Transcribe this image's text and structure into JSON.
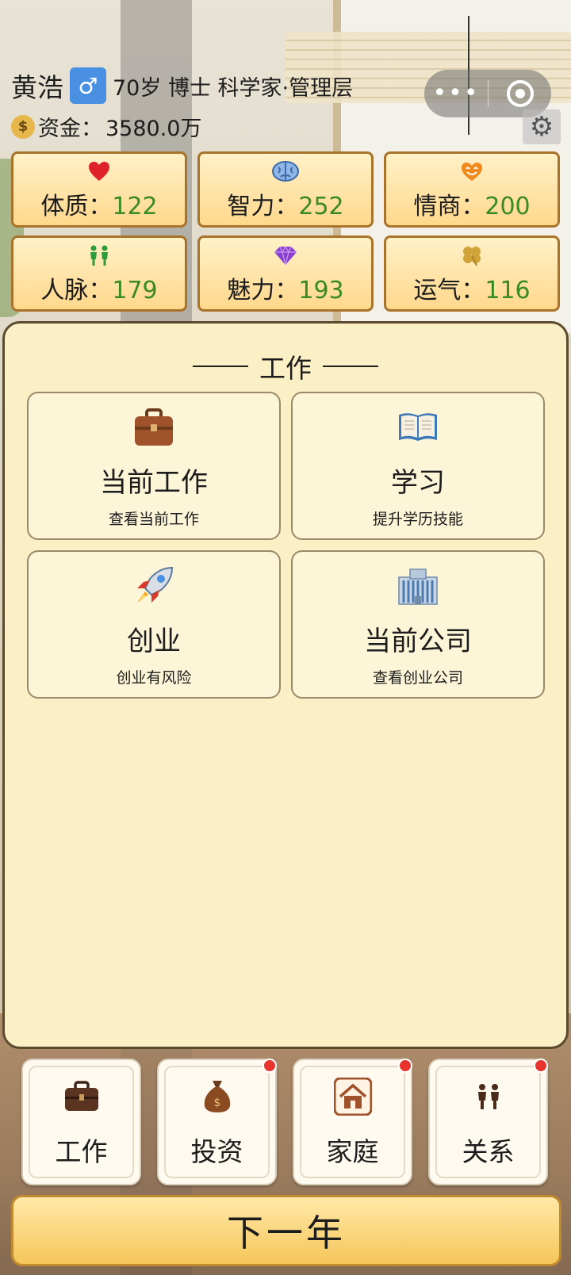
{
  "player": {
    "name": "黄浩",
    "gender_symbol": "♂",
    "info": "70岁 博士 科学家·管理层",
    "funds_label": "资金：",
    "funds_value": "3580.0万"
  },
  "capsule": {
    "more": "•••"
  },
  "stats": [
    {
      "label": "体质：",
      "value": "122",
      "icon": "heart-icon",
      "color": "#e0232a"
    },
    {
      "label": "智力：",
      "value": "252",
      "icon": "brain-icon",
      "color": "#4a7fc1"
    },
    {
      "label": "情商：",
      "value": "200",
      "icon": "smile-icon",
      "color": "#f08a1c"
    },
    {
      "label": "人脉：",
      "value": "179",
      "icon": "people-icon",
      "color": "#2e9c3a"
    },
    {
      "label": "魅力：",
      "value": "193",
      "icon": "gem-icon",
      "color": "#7a35c0"
    },
    {
      "label": "运气：",
      "value": "116",
      "icon": "clover-icon",
      "color": "#d1a43a"
    }
  ],
  "work_panel": {
    "title": "工作",
    "cards": [
      {
        "title": "当前工作",
        "subtitle": "查看当前工作",
        "icon": "briefcase-icon"
      },
      {
        "title": "学习",
        "subtitle": "提升学历技能",
        "icon": "book-icon"
      },
      {
        "title": "创业",
        "subtitle": "创业有风险",
        "icon": "rocket-icon"
      },
      {
        "title": "当前公司",
        "subtitle": "查看创业公司",
        "icon": "office-building-icon"
      }
    ]
  },
  "nav": [
    {
      "label": "工作",
      "icon": "briefcase-icon",
      "badge": false
    },
    {
      "label": "投资",
      "icon": "money-bag-icon",
      "badge": true
    },
    {
      "label": "家庭",
      "icon": "house-icon",
      "badge": true
    },
    {
      "label": "关系",
      "icon": "people-icon",
      "badge": true
    }
  ],
  "next_year": "下一年",
  "colors": {
    "stat_value": "#3a8a22",
    "panel_bg": "#fbefc5",
    "badge": "#e8342c"
  }
}
